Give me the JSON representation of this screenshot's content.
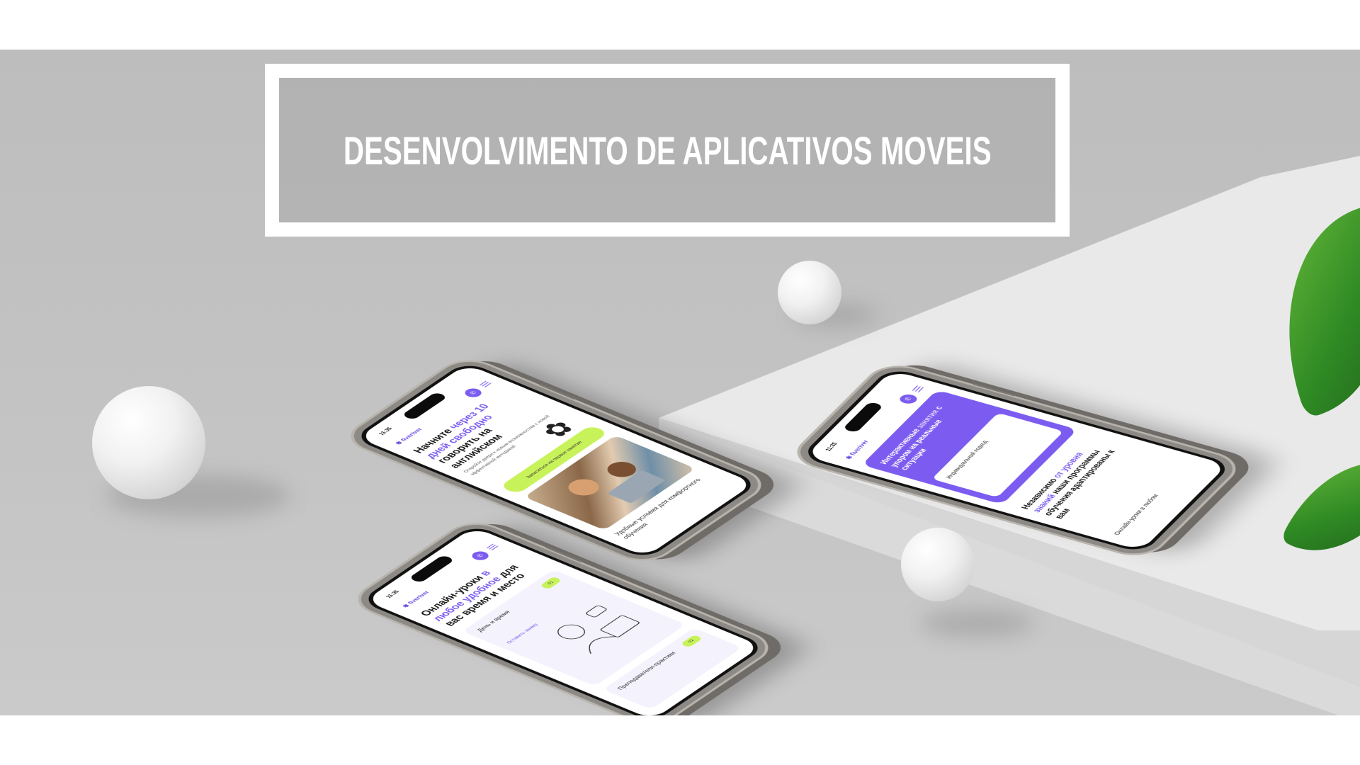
{
  "title": "DESENVOLVIMENTO DE APLICATIVOS MOVEIS",
  "colors": {
    "background": "#c2c2c2",
    "accent_violet": "#7c5cf0",
    "accent_lime": "#c7f25a",
    "frame": "#ffffff"
  },
  "phones": [
    {
      "status_time": "11:35",
      "brand": "fiveriver",
      "headline_part1": "Начните ",
      "headline_hl1": "через 10 дней",
      "headline_part2": " ",
      "headline_hl2": "свободно",
      "headline_part3": " говорить на английском",
      "subtext": "Откройте двери к новым возможностям с новой эффективной методикой",
      "cta_label": "Записаться на первое занятие",
      "footer_text": "Удобные условия для комфортного обучения",
      "icons": [
        "phone-icon",
        "menu-icon",
        "flower-icon"
      ]
    },
    {
      "status_time": "11:35",
      "brand": "fiveriver",
      "headline_part1": "Онлайн-уроки ",
      "headline_hl1": "в любое удобное",
      "headline_part2": " для вас время и место",
      "card_title": "День и время",
      "card_link": "Оставить заявку",
      "card2_title": "Преподаватели-практики",
      "pill_label": "01",
      "pill2_label": "02",
      "icons": [
        "phone-icon",
        "menu-icon"
      ]
    },
    {
      "status_time": "11:35",
      "brand": "fiveriver",
      "violet_title_part1": "Интерактивные ",
      "violet_title_hl": "занятия",
      "violet_title_part2": " с упором на реальные ситуации",
      "inner_title": "Индивидуальный подход",
      "bottom_text_part1": "Независимо ",
      "bottom_text_hl": "от уровня знаний",
      "bottom_text_part2": " наши программы обучения адаптированы к вам",
      "footer_text": "Онлайн-уроки в любом",
      "icons": [
        "phone-icon",
        "menu-icon"
      ]
    }
  ]
}
